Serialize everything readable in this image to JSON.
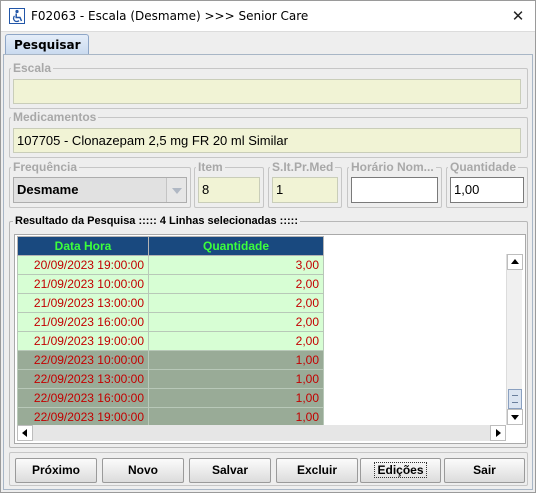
{
  "window": {
    "title": "F02063 - Escala (Desmame) >>> Senior Care",
    "close_glyph": "✕"
  },
  "tabs": [
    {
      "label": "Pesquisar",
      "selected": true
    }
  ],
  "form": {
    "escala": {
      "legend": "Escala",
      "value": ""
    },
    "medicamentos": {
      "legend": "Medicamentos",
      "value": "107705 - Clonazepam   2,5 mg  FR  20 ml   Similar"
    },
    "frequencia": {
      "legend": "Frequência",
      "value": "Desmame"
    },
    "item": {
      "legend": "Item",
      "value": "8"
    },
    "sltprmed": {
      "legend": "S.It.Pr.Med",
      "value": "1"
    },
    "horario": {
      "legend": "Horário Nom...",
      "value": ""
    },
    "quantidade": {
      "legend": "Quantidade",
      "value": "1,00"
    }
  },
  "results": {
    "legend": "Resultado da Pesquisa ::::: 4 Linhas selecionadas :::::",
    "columns": [
      "Data Hora",
      "Quantidade"
    ],
    "rows": [
      {
        "data_hora": "20/09/2023 19:00:00",
        "quantidade": "3,00",
        "shade": "light"
      },
      {
        "data_hora": "21/09/2023 10:00:00",
        "quantidade": "2,00",
        "shade": "light"
      },
      {
        "data_hora": "21/09/2023 13:00:00",
        "quantidade": "2,00",
        "shade": "light"
      },
      {
        "data_hora": "21/09/2023 16:00:00",
        "quantidade": "2,00",
        "shade": "light"
      },
      {
        "data_hora": "21/09/2023 19:00:00",
        "quantidade": "2,00",
        "shade": "light"
      },
      {
        "data_hora": "22/09/2023 10:00:00",
        "quantidade": "1,00",
        "shade": "dark"
      },
      {
        "data_hora": "22/09/2023 13:00:00",
        "quantidade": "1,00",
        "shade": "dark"
      },
      {
        "data_hora": "22/09/2023 16:00:00",
        "quantidade": "1,00",
        "shade": "dark"
      },
      {
        "data_hora": "22/09/2023 19:00:00",
        "quantidade": "1,00",
        "shade": "dark"
      }
    ]
  },
  "buttons": {
    "proximo": "Próximo",
    "novo": "Novo",
    "salvar": "Salvar",
    "excluir": "Excluir",
    "edicoes": "Edições",
    "sair": "Sair"
  },
  "colors": {
    "header_bg": "#19497f",
    "header_text": "#3cff3c",
    "row_light": "#d7fed4",
    "row_dark": "#99ab97",
    "cell_text": "#c30000",
    "field_bg": "#f1f3d5"
  },
  "icons": {
    "app": "wheelchair-icon",
    "close": "close-icon"
  }
}
